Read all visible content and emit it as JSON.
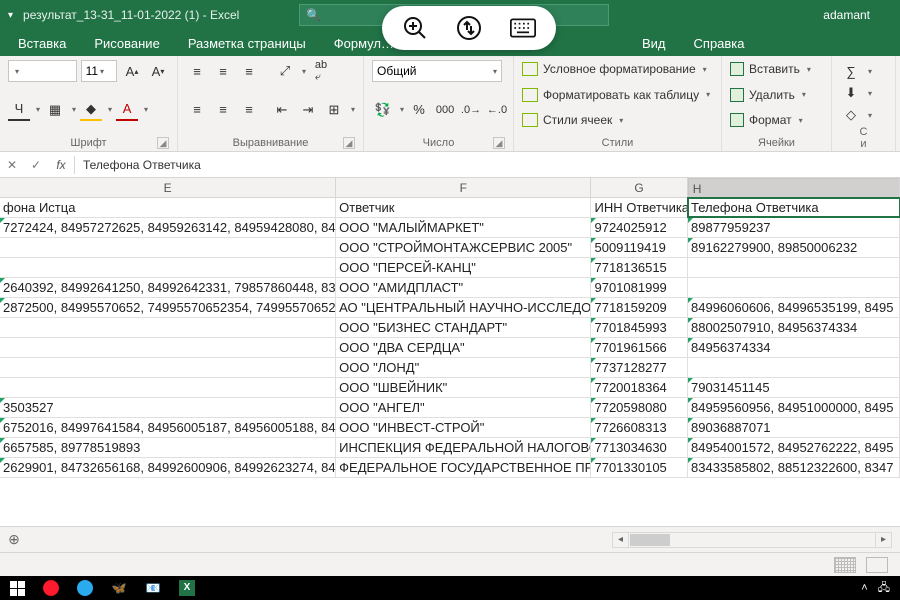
{
  "title": "результат_13-31_11-01-2022 (1) - Excel",
  "user": "adamant",
  "tabs": [
    "Вставка",
    "Рисование",
    "Разметка страницы",
    "Формул…",
    "",
    "Вид",
    "Справка"
  ],
  "font": {
    "size": "11",
    "name_dd": "▾"
  },
  "number_format": "Общий",
  "styles": {
    "cond": "Условное форматирование",
    "table": "Форматировать как таблицу",
    "cell": "Стили ячеек"
  },
  "cells": {
    "insert": "Вставить",
    "delete": "Удалить",
    "format": "Формат"
  },
  "grp": {
    "font": "Шрифт",
    "align": "Выравнивание",
    "number": "Число",
    "styles": "Стили",
    "cells": "Ячейки",
    "edit_partial": "С\nи"
  },
  "formula_value": "Телефона Ответчика",
  "cols": {
    "E": "E",
    "F": "F",
    "G": "G",
    "H": "H"
  },
  "headers": {
    "E": "фона Истца",
    "F": "Ответчик",
    "G": "ИНН Ответчика",
    "H": "Телефона Ответчика"
  },
  "rows": [
    {
      "E": "7272424, 84957272625, 84959263142, 84959428080, 84",
      "F": "ООО \"МАЛЫЙМАРКЕТ\"",
      "G": "9724025912",
      "H": "89877959237"
    },
    {
      "E": "",
      "F": "ООО \"СТРОЙМОНТАЖСЕРВИС 2005\"",
      "G": "5009119419",
      "H": "89162279900, 89850006232"
    },
    {
      "E": "",
      "F": "ООО \"ПЕРСЕЙ-КАНЦ\"",
      "G": "7718136515",
      "H": ""
    },
    {
      "E": "2640392, 84992641250, 84992642331, 79857860448, 83",
      "F": "ООО \"АМИДПЛАСТ\"",
      "G": "9701081999",
      "H": ""
    },
    {
      "E": "2872500, 84995570652, 74995570652354, 74995570652",
      "F": "АО \"ЦЕНТРАЛЬНЫЙ НАУЧНО-ИССЛЕДОВАТЕ",
      "G": "7718159209",
      "H": "84996060606, 84996535199, 8495"
    },
    {
      "E": "",
      "F": "ООО \"БИЗНЕС СТАНДАРТ\"",
      "G": "7701845993",
      "H": "88002507910, 84956374334"
    },
    {
      "E": "",
      "F": "ООО \"ДВА СЕРДЦА\"",
      "G": "7701961566",
      "H": "84956374334"
    },
    {
      "E": "",
      "F": "ООО \"ЛОНД\"",
      "G": "7737128277",
      "H": ""
    },
    {
      "E": "",
      "F": "ООО \"ШВЕЙНИК\"",
      "G": "7720018364",
      "H": "79031451145"
    },
    {
      "E": "3503527",
      "F": "ООО \"АНГЕЛ\"",
      "G": "7720598080",
      "H": "84959560956, 84951000000, 8495"
    },
    {
      "E": "6752016, 84997641584, 84956005187, 84956005188, 84",
      "F": "ООО \"ИНВЕСТ-СТРОЙ\"",
      "G": "7726608313",
      "H": "89036887071"
    },
    {
      "E": "6657585, 89778519893",
      "F": "ИНСПЕКЦИЯ ФЕДЕРАЛЬНОЙ НАЛОГОВОЙ СЛ",
      "G": "7713034630",
      "H": "84954001572, 84952762222, 8495"
    },
    {
      "E": "2629901, 84732656168, 84992600906, 84992623274, 84",
      "F": "ФЕДЕРАЛЬНОЕ ГОСУДАРСТВЕННОЕ ПРЕДПР",
      "G": "7701330105",
      "H": "83433585802, 88512322600, 8347"
    }
  ]
}
